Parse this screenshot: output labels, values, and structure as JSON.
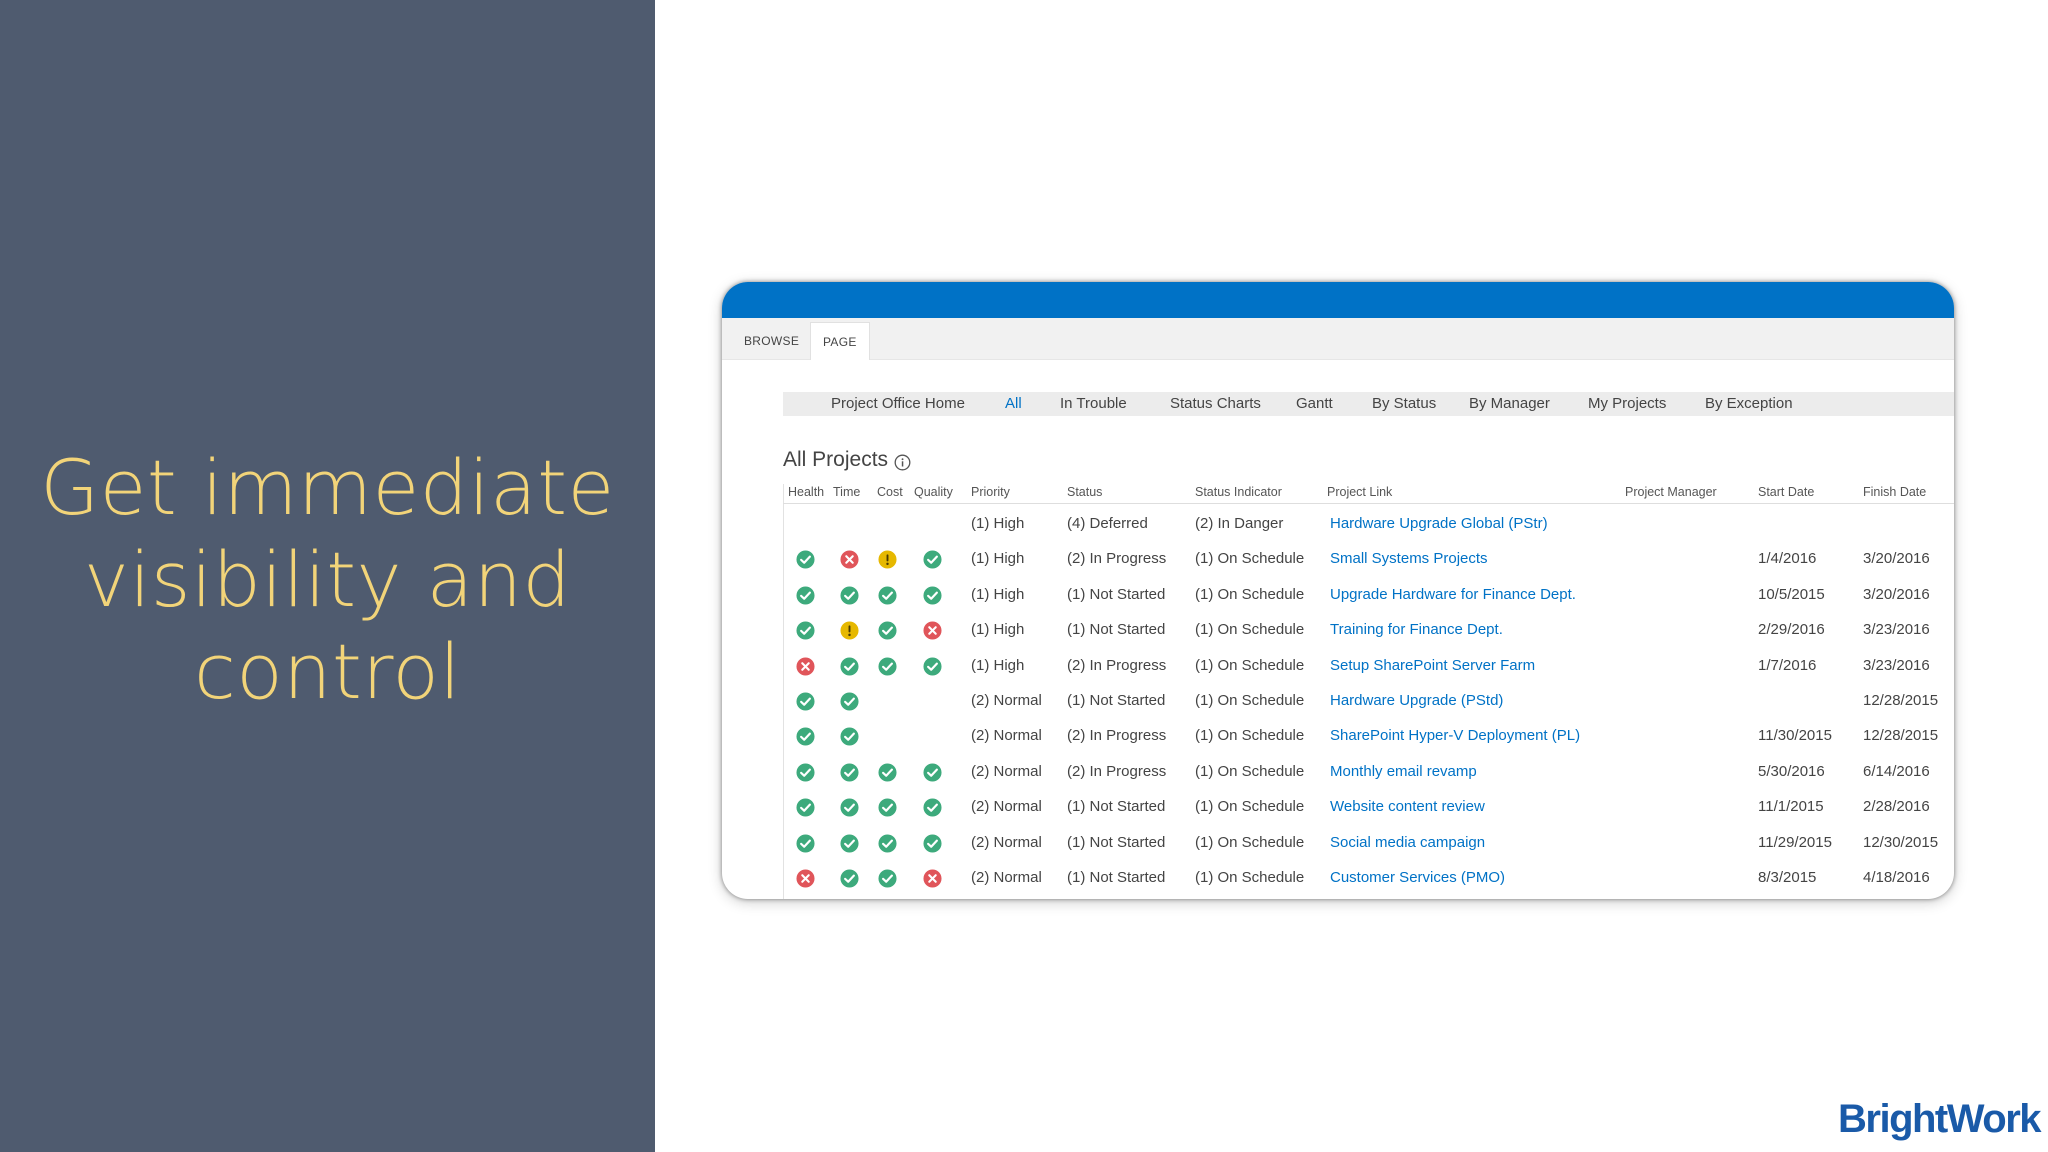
{
  "slide": {
    "headline_lines": [
      "Get immediate",
      "visibility and",
      "control"
    ]
  },
  "colors": {
    "left_panel": "#4f5b6f",
    "headline": "#f2d479",
    "window_bar": "#0072c6",
    "link": "#0072c6",
    "ok": "#3daa7c",
    "warning": "#e6b800",
    "error": "#e0555a",
    "logo": "#1a5aa8"
  },
  "ribbon": {
    "tabs": [
      "BROWSE",
      "PAGE"
    ],
    "selected": "PAGE"
  },
  "nav": {
    "items": [
      "Project Office Home",
      "All",
      "In Trouble",
      "Status Charts",
      "Gantt",
      "By Status",
      "By Manager",
      "My Projects",
      "By Exception"
    ],
    "active": "All"
  },
  "list": {
    "title": "All Projects",
    "title_icon": "info-icon",
    "columns": [
      "Health",
      "Time",
      "Cost",
      "Quality",
      "Priority",
      "Status",
      "Status Indicator",
      "Project Link",
      "Project Manager",
      "Start Date",
      "Finish Date"
    ],
    "rows": [
      {
        "health": "",
        "time": "",
        "cost": "",
        "quality": "",
        "priority": "(1) High",
        "status": "(4) Deferred",
        "indicator": "(2) In Danger",
        "project": "Hardware Upgrade Global (PStr)",
        "manager": "",
        "start": "",
        "finish": ""
      },
      {
        "health": "ok",
        "time": "error",
        "cost": "warning",
        "quality": "ok",
        "priority": "(1) High",
        "status": "(2) In Progress",
        "indicator": "(1) On Schedule",
        "project": "Small Systems Projects",
        "manager": "",
        "start": "1/4/2016",
        "finish": "3/20/2016"
      },
      {
        "health": "ok",
        "time": "ok",
        "cost": "ok",
        "quality": "ok",
        "priority": "(1) High",
        "status": "(1) Not Started",
        "indicator": "(1) On Schedule",
        "project": "Upgrade Hardware for Finance Dept.",
        "manager": "",
        "start": "10/5/2015",
        "finish": "3/20/2016"
      },
      {
        "health": "ok",
        "time": "warning",
        "cost": "ok",
        "quality": "error",
        "priority": "(1) High",
        "status": "(1) Not Started",
        "indicator": "(1) On Schedule",
        "project": "Training for Finance Dept.",
        "manager": "",
        "start": "2/29/2016",
        "finish": "3/23/2016"
      },
      {
        "health": "error",
        "time": "ok",
        "cost": "ok",
        "quality": "ok",
        "priority": "(1) High",
        "status": "(2) In Progress",
        "indicator": "(1) On Schedule",
        "project": "Setup SharePoint Server Farm",
        "manager": "",
        "start": "1/7/2016",
        "finish": "3/23/2016"
      },
      {
        "health": "ok",
        "time": "ok",
        "cost": "",
        "quality": "",
        "priority": "(2) Normal",
        "status": "(1) Not Started",
        "indicator": "(1) On Schedule",
        "project": "Hardware Upgrade (PStd)",
        "manager": "",
        "start": "",
        "finish": "12/28/2015"
      },
      {
        "health": "ok",
        "time": "ok",
        "cost": "",
        "quality": "",
        "priority": "(2) Normal",
        "status": "(2) In Progress",
        "indicator": "(1) On Schedule",
        "project": "SharePoint Hyper-V Deployment (PL)",
        "manager": "",
        "start": "11/30/2015",
        "finish": "12/28/2015"
      },
      {
        "health": "ok",
        "time": "ok",
        "cost": "ok",
        "quality": "ok",
        "priority": "(2) Normal",
        "status": "(2) In Progress",
        "indicator": "(1) On Schedule",
        "project": "Monthly email revamp",
        "manager": "",
        "start": "5/30/2016",
        "finish": "6/14/2016"
      },
      {
        "health": "ok",
        "time": "ok",
        "cost": "ok",
        "quality": "ok",
        "priority": "(2) Normal",
        "status": "(1) Not Started",
        "indicator": "(1) On Schedule",
        "project": "Website content review",
        "manager": "",
        "start": "11/1/2015",
        "finish": "2/28/2016"
      },
      {
        "health": "ok",
        "time": "ok",
        "cost": "ok",
        "quality": "ok",
        "priority": "(2) Normal",
        "status": "(1) Not Started",
        "indicator": "(1) On Schedule",
        "project": "Social media campaign",
        "manager": "",
        "start": "11/29/2015",
        "finish": "12/30/2015"
      },
      {
        "health": "error",
        "time": "ok",
        "cost": "ok",
        "quality": "error",
        "priority": "(2) Normal",
        "status": "(1) Not Started",
        "indicator": "(1) On Schedule",
        "project": "Customer Services (PMO)",
        "manager": "",
        "start": "8/3/2015",
        "finish": "4/18/2016"
      }
    ]
  },
  "brand": {
    "logo_text": "BrightWork"
  }
}
